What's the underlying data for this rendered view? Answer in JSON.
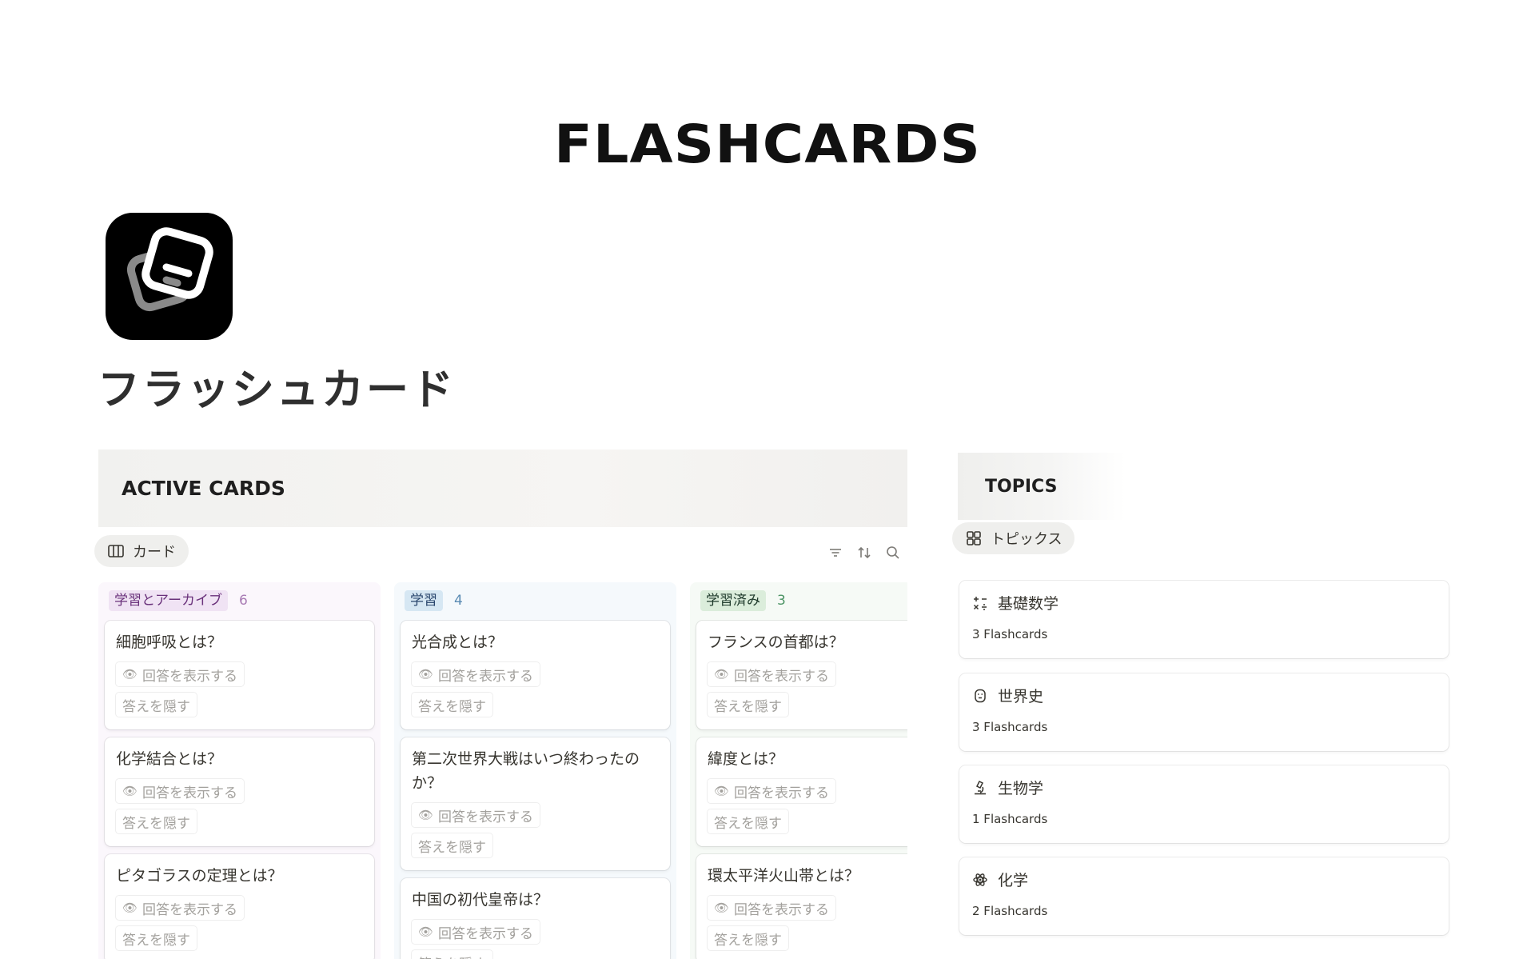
{
  "banner": {
    "title": "FLASHCARDS"
  },
  "page": {
    "title": "フラッシュカード"
  },
  "active_cards": {
    "heading": "ACTIVE CARDS",
    "view_tab": {
      "label": "カード",
      "icon": "board-icon"
    },
    "toolbar": [
      "filter-icon",
      "sort-icon",
      "search-icon"
    ],
    "columns": [
      {
        "tag": "学習とアーカイブ",
        "count": "6",
        "tag_bg": "#f0e3f4",
        "tag_color": "#69307a",
        "count_color": "#a87bb4",
        "col_bg": "#fbf7fc",
        "cards": [
          {
            "question": "細胞呼吸とは？",
            "show": "回答を表示する",
            "hide": "答えを隠す"
          },
          {
            "question": "化学結合とは？",
            "show": "回答を表示する",
            "hide": "答えを隠す"
          },
          {
            "question": "ピタゴラスの定理とは？",
            "show": "回答を表示する",
            "hide": "答えを隠す"
          }
        ]
      },
      {
        "tag": "学習",
        "count": "4",
        "tag_bg": "#d6e7f3",
        "tag_color": "#28456c",
        "count_color": "#5a8bb3",
        "col_bg": "#f5f9fc",
        "cards": [
          {
            "question": "光合成とは？",
            "show": "回答を表示する",
            "hide": "答えを隠す"
          },
          {
            "question": "第二次世界大戦はいつ終わったのか？",
            "show": "回答を表示する",
            "hide": "答えを隠す"
          },
          {
            "question": "中国の初代皇帝は？",
            "show": "回答を表示する",
            "hide": "答えを隠す"
          }
        ]
      },
      {
        "tag": "学習済み",
        "count": "3",
        "tag_bg": "#dbeddb",
        "tag_color": "#1c3829",
        "count_color": "#4d9465",
        "col_bg": "#f6faf6",
        "cards": [
          {
            "question": "フランスの首都は？",
            "show": "回答を表示する",
            "hide": "答えを隠す"
          },
          {
            "question": "緯度とは？",
            "show": "回答を表示する",
            "hide": "答えを隠す"
          },
          {
            "question": "環太平洋火山帯とは？",
            "show": "回答を表示する",
            "hide": "答えを隠す"
          }
        ]
      }
    ]
  },
  "topics": {
    "heading": "TOPICS",
    "view_tab": {
      "label": "トピックス",
      "icon": "gallery-icon"
    },
    "items": [
      {
        "name": "基礎数学",
        "count": "3 Flashcards",
        "icon": "math-operators-icon"
      },
      {
        "name": "世界史",
        "count": "3 Flashcards",
        "icon": "history-head-icon"
      },
      {
        "name": "生物学",
        "count": "1 Flashcards",
        "icon": "microscope-icon"
      },
      {
        "name": "化学",
        "count": "2 Flashcards",
        "icon": "atom-icon"
      }
    ]
  }
}
